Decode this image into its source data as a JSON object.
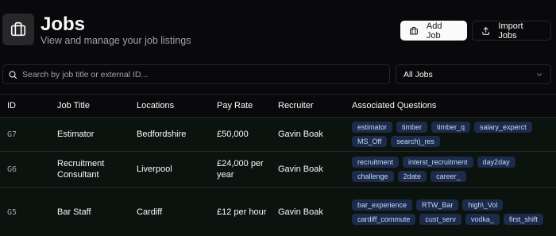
{
  "header": {
    "title": "Jobs",
    "subtitle": "View and manage your job listings",
    "icon": "briefcase-icon"
  },
  "actions": {
    "add_label": "Add Job",
    "import_label": "Import Jobs"
  },
  "search": {
    "placeholder": "Search by job title or external ID..."
  },
  "filter": {
    "selected": "All Jobs"
  },
  "table": {
    "columns": [
      "ID",
      "Job Title",
      "Locations",
      "Pay Rate",
      "Recruiter",
      "Associated Questions"
    ],
    "rows": [
      {
        "id": "G7",
        "title": "Estimator",
        "location": "Bedfordshire",
        "pay": "£50,000",
        "recruiter": "Gavin Boak",
        "questions": [
          "estimator",
          "timber",
          "timber_q",
          "salary_experct",
          "MS_Off",
          "search)_res"
        ]
      },
      {
        "id": "G6",
        "title": "Recruitment Consultant",
        "location": "Liverpool",
        "pay": "£24,000 per year",
        "recruiter": "Gavin Boak",
        "questions": [
          "recruitment",
          "interst_recruitment",
          "day2day",
          "challenge",
          "2date",
          "career_"
        ]
      },
      {
        "id": "G5",
        "title": "Bar Staff",
        "location": "Cardiff",
        "pay": "£12 per hour",
        "recruiter": "Gavin Boak",
        "questions": [
          "bar_experience",
          "RTW_Bar",
          "high\\_Vol",
          "cardiff_commute",
          "cust_serv",
          "vodka_",
          "first_shift"
        ]
      }
    ]
  },
  "colors": {
    "background": "#09090b",
    "row_background": "#0b130f",
    "tag_background": "#1e2a4a",
    "tag_text": "#bfdbfe",
    "border": "#27272a"
  }
}
